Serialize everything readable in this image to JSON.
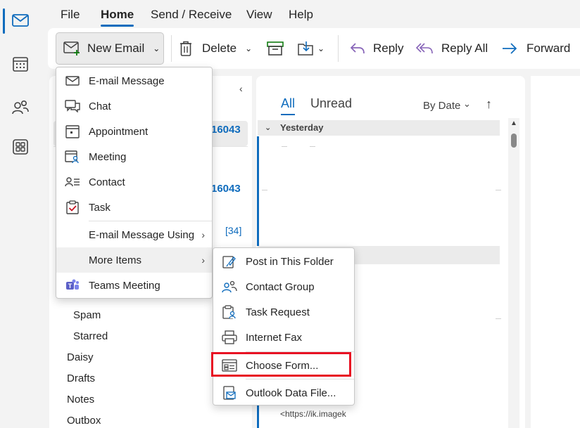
{
  "menubar": {
    "tabs": [
      "File",
      "Home",
      "Send / Receive",
      "View",
      "Help"
    ]
  },
  "ribbon": {
    "new_email": "New Email",
    "delete": "Delete",
    "reply": "Reply",
    "reply_all": "Reply All",
    "forward": "Forward"
  },
  "folders": {
    "spam": "Spam",
    "starred": "Starred",
    "daisy": "Daisy",
    "drafts": "Drafts",
    "notes": "Notes",
    "outbox": "Outbox",
    "count1": "16043",
    "count2": "16043",
    "count3": "[34]"
  },
  "list": {
    "tab_all": "All",
    "tab_unread": "Unread",
    "sort": "By Date",
    "group_yesterday": "Yesterday",
    "url_preview": "<https://ik.imagek"
  },
  "new_menu": {
    "items": [
      "E-mail Message",
      "Chat",
      "Appointment",
      "Meeting",
      "Contact",
      "Task",
      "E-mail Message Using",
      "More Items",
      "Teams Meeting"
    ]
  },
  "more_menu": {
    "items": [
      "Post in This Folder",
      "Contact Group",
      "Task Request",
      "Internet Fax",
      "Choose Form...",
      "Outlook Data File..."
    ]
  },
  "colors": {
    "accent": "#0f6cbd",
    "highlight": "#e81123",
    "teams": "#5b5fc7"
  }
}
